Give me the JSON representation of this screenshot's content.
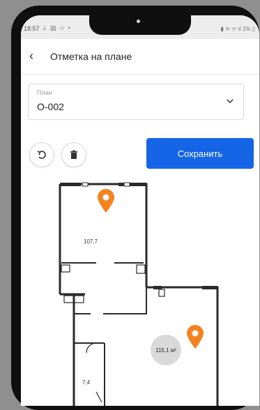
{
  "status_bar": {
    "time": "18:57",
    "battery": "1%"
  },
  "app_bar": {
    "title": "Отметка на плане",
    "back_icon": "arrow-left-icon"
  },
  "plan_select": {
    "label": "План",
    "value": "О-002"
  },
  "toolbar": {
    "undo_icon": "undo-icon",
    "delete_icon": "trash-icon",
    "save_label": "Сохранить"
  },
  "floor_plan": {
    "rooms": [
      {
        "label": "107,7"
      },
      {
        "label": "115,1 м²"
      },
      {
        "label": "7,4"
      }
    ],
    "markers": [
      "map-pin-icon",
      "map-pin-icon"
    ]
  },
  "colors": {
    "accent": "#1565e6",
    "marker": "#f5821f",
    "wall": "#2a2a2a"
  }
}
